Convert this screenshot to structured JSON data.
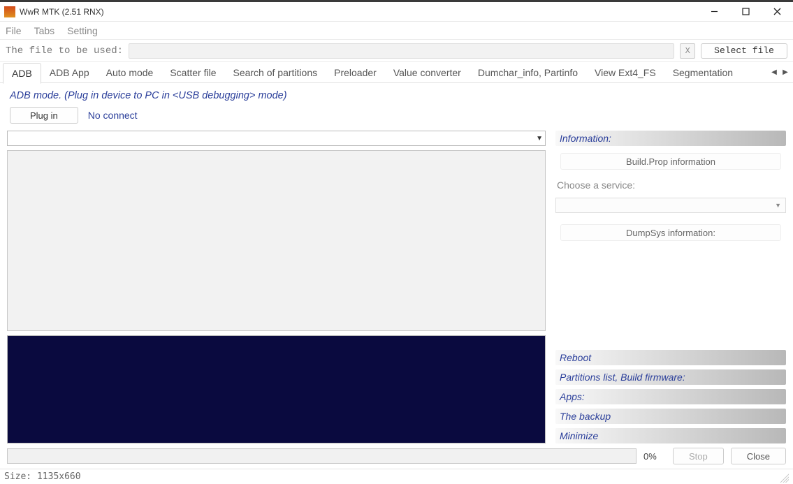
{
  "window": {
    "title": "WwR MTK (2.51 RNX)"
  },
  "menu": {
    "file": "File",
    "tabs": "Tabs",
    "setting": "Setting"
  },
  "file_row": {
    "label": "The file to be used:",
    "value": "",
    "clear": "X",
    "select_btn": "Select file"
  },
  "tabs": {
    "active": "ADB",
    "items": [
      "ADB",
      "ADB App",
      "Auto mode",
      "Scatter file",
      "Search of partitions",
      "Preloader",
      "Value converter",
      "Dumchar_info, Partinfo",
      "View Ext4_FS",
      "Segmentation"
    ]
  },
  "adb": {
    "mode_line": "ADB mode. (Plug in device to PC in <USB debugging> mode)",
    "plug_in_btn": "Plug in",
    "status": "No connect",
    "combo_value": ""
  },
  "right": {
    "info_header": "Information:",
    "buildprop_btn": "Build.Prop information",
    "choose_label": "Choose a service:",
    "service_value": "",
    "dumpsys_btn": "DumpSys information:",
    "sections": {
      "reboot": "Reboot",
      "partitions": "Partitions list, Build firmware:",
      "apps": "Apps:",
      "backup": "The backup",
      "minimize": "Minimize"
    }
  },
  "bottom": {
    "percent": "0%",
    "stop": "Stop",
    "close": "Close"
  },
  "status": {
    "size": "Size: 1135x660"
  }
}
